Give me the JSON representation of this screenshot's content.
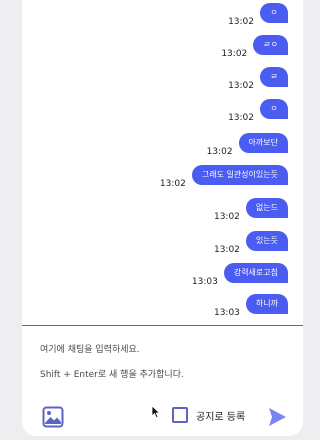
{
  "messages": [
    {
      "time": "13:02",
      "text": "ㅇ"
    },
    {
      "time": "13:02",
      "text": "ㄹㅇ"
    },
    {
      "time": "13:02",
      "text": "ㄹ"
    },
    {
      "time": "13:02",
      "text": "ㅇ"
    },
    {
      "time": "13:02",
      "text": "아까보단"
    },
    {
      "time": "13:02",
      "text": "그래도 일관성이있는듯"
    },
    {
      "time": "13:02",
      "text": "없는드"
    },
    {
      "time": "13:02",
      "text": "있는듯"
    },
    {
      "time": "13:03",
      "text": "강력새로고침"
    },
    {
      "time": "13:03",
      "text": "하니까"
    }
  ],
  "composer": {
    "placeholder": "여기에 채팅을 입력하세요.\nShift + Enter로 새 행을 추가합니다.",
    "notice_label": "공지로 등록",
    "notice_checked": false
  },
  "colors": {
    "bubble": "#4b5cf0",
    "accent": "#5b63c4",
    "send": "#7a84f2"
  },
  "icons": {
    "attach": "image-icon",
    "send": "send-icon"
  }
}
